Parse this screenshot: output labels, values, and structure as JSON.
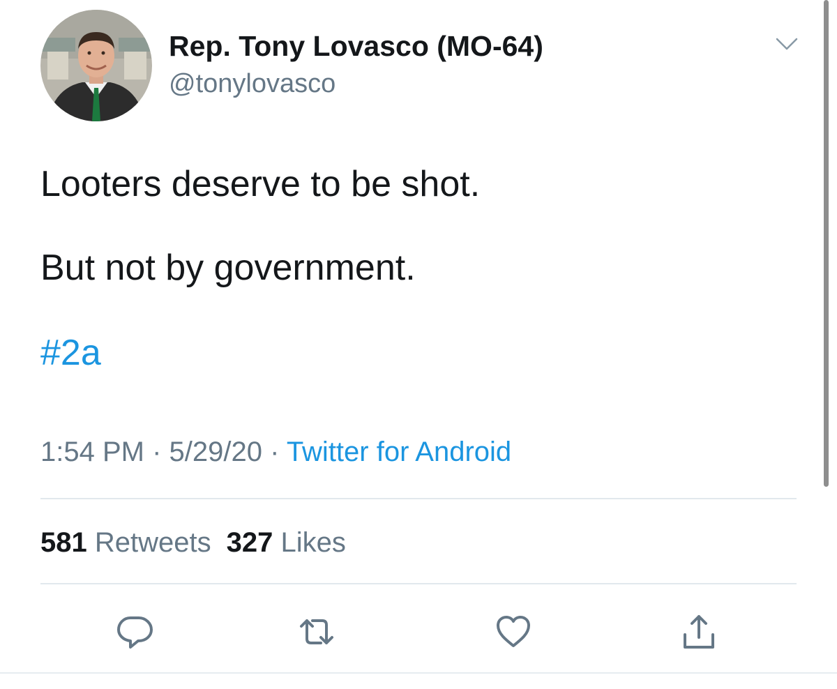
{
  "author": {
    "display_name": "Rep. Tony Lovasco (MO-64)",
    "handle": "@tonylovasco",
    "avatar_icon": "profile-photo"
  },
  "tweet": {
    "line1": "Looters deserve to be shot.",
    "line2": "But not by government.",
    "hashtag": "#2a"
  },
  "meta": {
    "time": "1:54 PM",
    "separator": " · ",
    "date": "5/29/20",
    "source": "Twitter for Android"
  },
  "stats": {
    "retweets_count": "581",
    "retweets_label": "Retweets",
    "likes_count": "327",
    "likes_label": "Likes"
  },
  "actions": {
    "reply_icon": "speech-bubble",
    "retweet_icon": "retweet-arrows",
    "like_icon": "heart",
    "share_icon": "share-upload"
  },
  "colors": {
    "text": "#14171a",
    "secondary": "#657786",
    "link": "#1b95e0",
    "divider": "#e1e8ed"
  }
}
